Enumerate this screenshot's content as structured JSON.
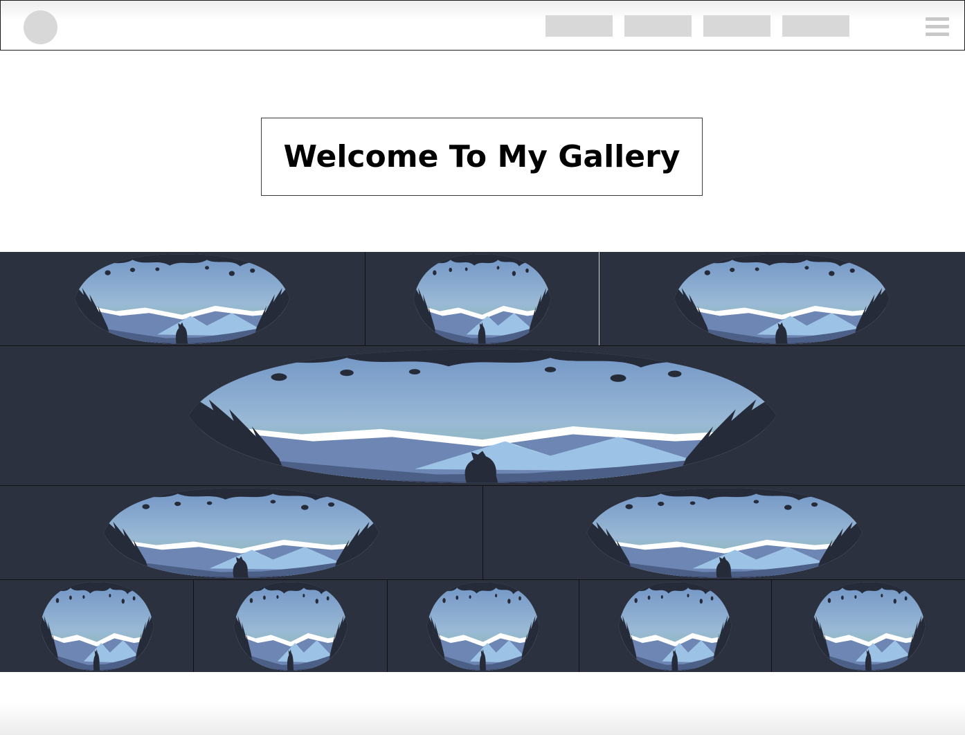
{
  "header": {
    "nav_item_count": 4
  },
  "page": {
    "title": "Welcome To My Gallery"
  },
  "gallery": {
    "tile_count": 11,
    "image_name": "wolf-forest-window-illustration",
    "colors": {
      "frame": "#2c313f",
      "sky_top": "#6f93c4",
      "sky_horizon": "#8ab8b3",
      "mountain": "#9cc3e6",
      "snow": "#ffffff",
      "forest": "#4c5f86",
      "silhouette": "#262b3a"
    }
  }
}
